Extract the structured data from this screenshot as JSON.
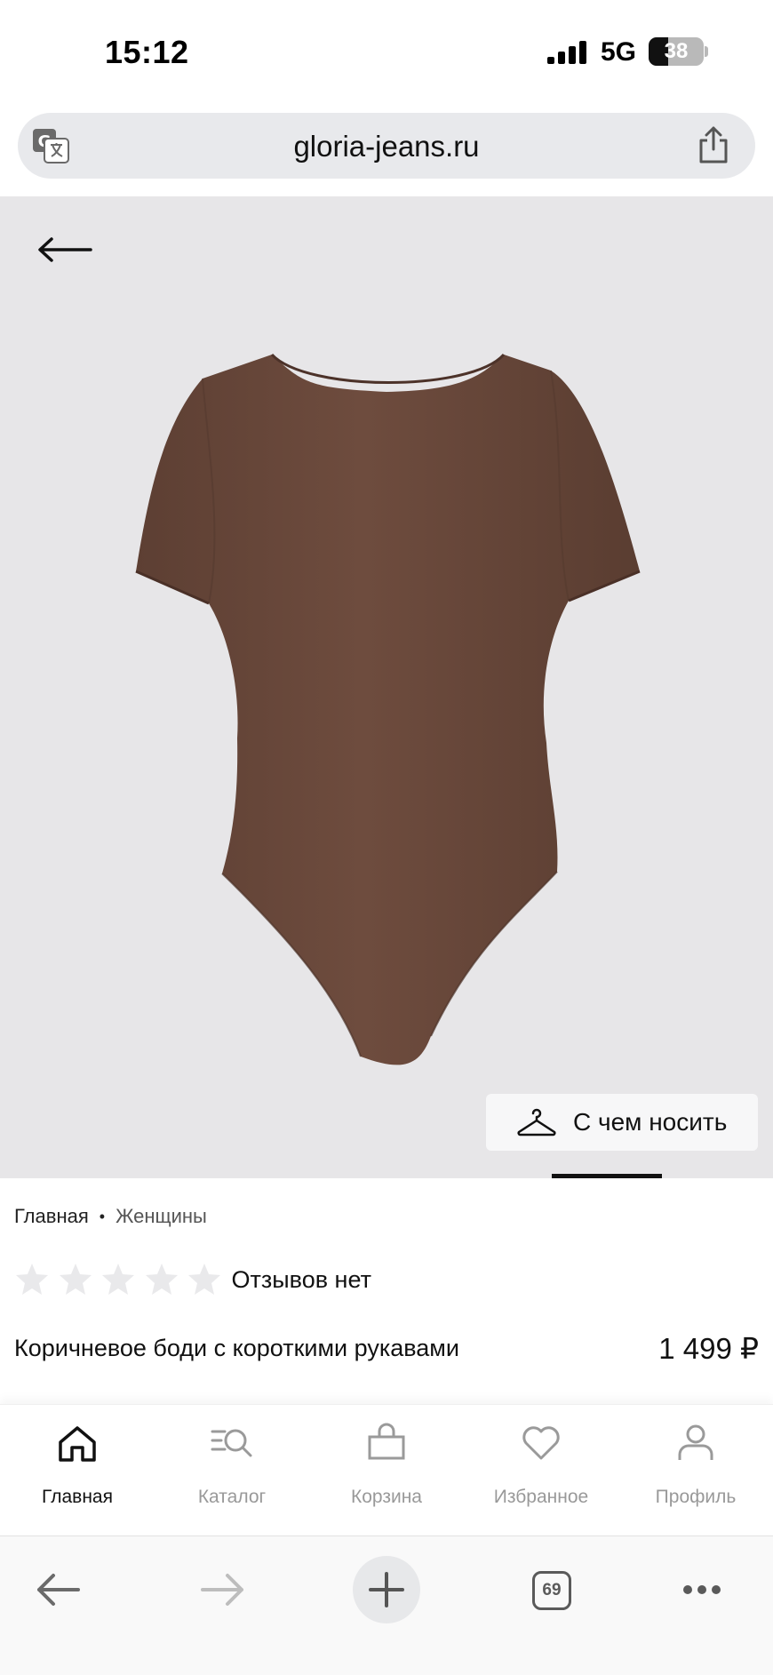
{
  "status_bar": {
    "time": "15:12",
    "network": "5G",
    "battery": "38"
  },
  "browser": {
    "url": "gloria-jeans.ru",
    "tabs_count": "69"
  },
  "product": {
    "wear_button_label": "С чем носить",
    "breadcrumb": [
      "Главная",
      "Женщины"
    ],
    "rating_stars": 0,
    "rating_max": 5,
    "reviews_text": "Отзывов нет",
    "title": "Коричневое боди с короткими рукавами",
    "price": "1 499 ₽",
    "image_color": "#6b4a3c"
  },
  "app_nav": {
    "items": [
      {
        "label": "Главная",
        "icon": "home-icon",
        "active": true
      },
      {
        "label": "Каталог",
        "icon": "catalog-search-icon",
        "active": false
      },
      {
        "label": "Корзина",
        "icon": "bag-icon",
        "active": false
      },
      {
        "label": "Избранное",
        "icon": "heart-icon",
        "active": false
      },
      {
        "label": "Профиль",
        "icon": "profile-icon",
        "active": false
      }
    ]
  }
}
